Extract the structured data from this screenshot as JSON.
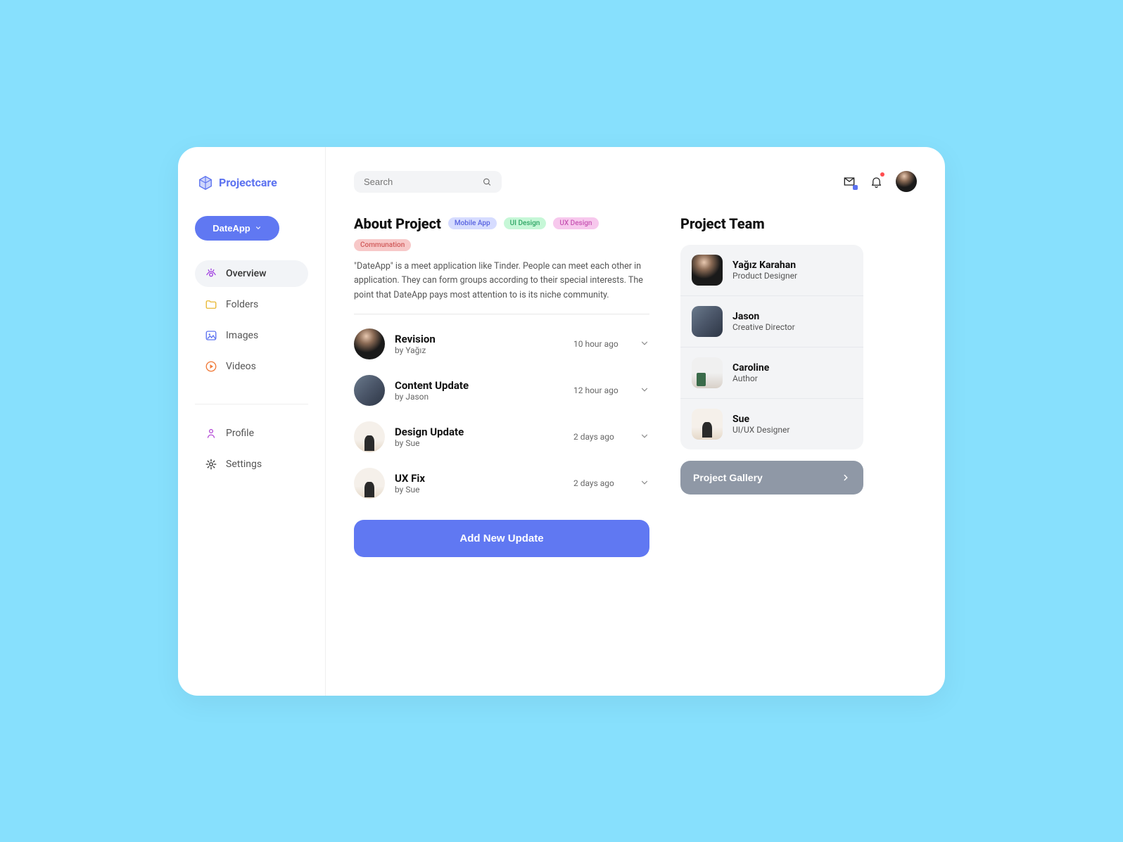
{
  "brand": "Projectcare",
  "project_selector": "DateApp",
  "search_placeholder": "Search",
  "sidebar": {
    "items": [
      {
        "label": "Overview",
        "active": true
      },
      {
        "label": "Folders"
      },
      {
        "label": "Images"
      },
      {
        "label": "Videos"
      }
    ],
    "bottom": [
      {
        "label": "Profile"
      },
      {
        "label": "Settings"
      }
    ]
  },
  "about": {
    "title": "About Project",
    "tags": [
      "Mobile App",
      "UI Design",
      "UX Design",
      "Communation"
    ],
    "description": "\"DateApp\" is a meet application like Tinder. People can meet each other in application. They can form groups according to their special interests. The point that DateApp pays most attention to is its niche community."
  },
  "updates": [
    {
      "title": "Revision",
      "by": "by Yağız",
      "time": "10 hour ago"
    },
    {
      "title": "Content Update",
      "by": "by Jason",
      "time": "12 hour ago"
    },
    {
      "title": "Design Update",
      "by": "by Sue",
      "time": "2 days ago"
    },
    {
      "title": "UX Fix",
      "by": "by Sue",
      "time": "2 days ago"
    }
  ],
  "add_button": "Add New Update",
  "team": {
    "title": "Project Team",
    "members": [
      {
        "name": "Yağız Karahan",
        "role": "Product Designer"
      },
      {
        "name": "Jason",
        "role": "Creative Director"
      },
      {
        "name": "Caroline",
        "role": "Author"
      },
      {
        "name": "Sue",
        "role": "UI/UX Designer"
      }
    ],
    "gallery_label": "Project Gallery"
  }
}
